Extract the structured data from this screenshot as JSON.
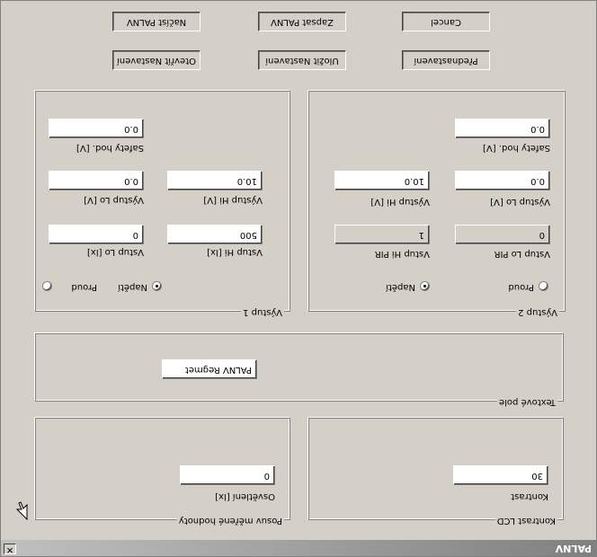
{
  "window": {
    "title": "PALNV",
    "close_glyph": "✕"
  },
  "groups": {
    "lcd_contrast": {
      "label": "Kontrast LCD",
      "field_label": "Kontrast",
      "value": "30"
    },
    "value_shift": {
      "label": "Posuv měřené hodnoty",
      "field_label": "Osvětlení [lx]",
      "value": "0"
    },
    "text_field": {
      "label": "Textové pole",
      "value": "PALNV Regmet"
    },
    "output1": {
      "label": "Výstup 1",
      "radio_current": "Proud",
      "radio_voltage": "Napětí",
      "selected": "Napětí",
      "vstup_lo_label": "Vstup Lo [lx]",
      "vstup_lo": "0",
      "vstup_hi_label": "Vstup Hi [lx]",
      "vstup_hi": "500",
      "vystup_lo_label": "Výstup Lo [V]",
      "vystup_lo": "0.0",
      "vystup_hi_label": "Výstup Hi [V]",
      "vystup_hi": "10.0",
      "safety_label": "Safety hod. [V]",
      "safety": "0.0"
    },
    "output2": {
      "label": "Výstup 2",
      "radio_current": "Proud",
      "radio_voltage": "Napětí",
      "selected": "Napětí",
      "vstup_lo_label": "Vstup Lo PIR",
      "vstup_lo": "0",
      "vstup_hi_label": "Vstup Hi PIR",
      "vstup_hi": "1",
      "vystup_lo_label": "Výstup Lo [V]",
      "vystup_lo": "0.0",
      "vystup_hi_label": "Výstup Hi [V]",
      "vystup_hi": "10.0",
      "safety_label": "Safety hod. [V]",
      "safety": "0.0"
    }
  },
  "buttons": {
    "open_settings": "Otevřít Nastavení",
    "save_settings": "Uložit Nastavení",
    "defaults": "Přednastavení",
    "read": "Načíst PALNV",
    "write": "Zapsat PALNV",
    "cancel": "Cancel"
  }
}
